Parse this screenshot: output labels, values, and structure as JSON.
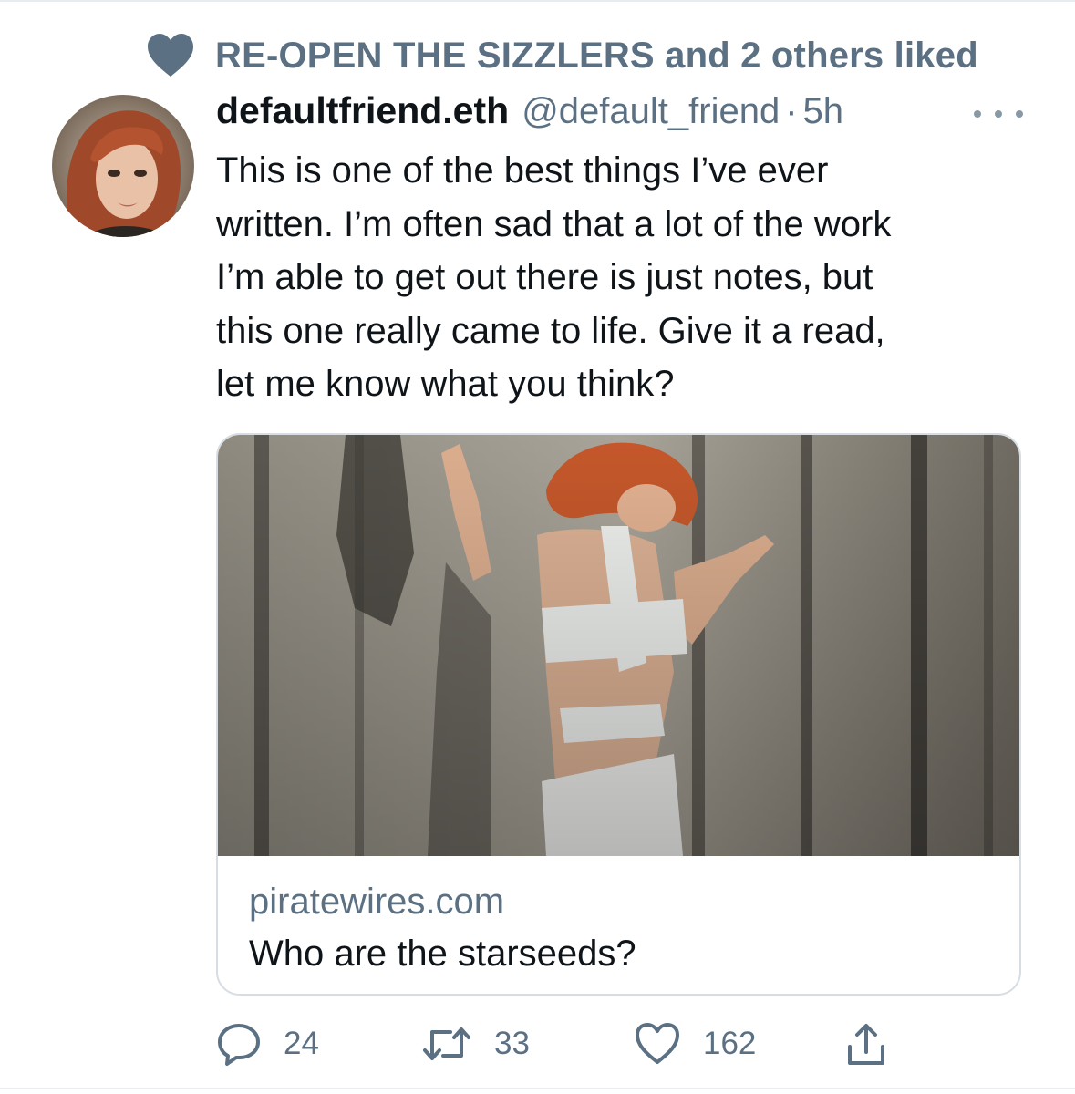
{
  "social_context": {
    "text": "RE-OPEN THE SIZZLERS and 2 others liked",
    "icon": "heart-icon"
  },
  "author": {
    "display_name": "defaultfriend.eth",
    "handle": "@default_friend",
    "separator": "·",
    "time": "5h"
  },
  "tweet": {
    "lines": [
      "This is one of the best things I’ve ever",
      "written. I’m often sad that a lot of the work",
      "I’m able to get out there is just notes, but",
      "this one really came to life. Give it a read,",
      "let me know what you think?"
    ]
  },
  "card": {
    "domain": "piratewires.com",
    "title": "Who are the starseeds?"
  },
  "actions": {
    "reply_count": "24",
    "retweet_count": "33",
    "like_count": "162"
  },
  "colors": {
    "secondary_text": "#5b7083",
    "primary_text": "#0f1419",
    "border": "#d6dde3"
  }
}
